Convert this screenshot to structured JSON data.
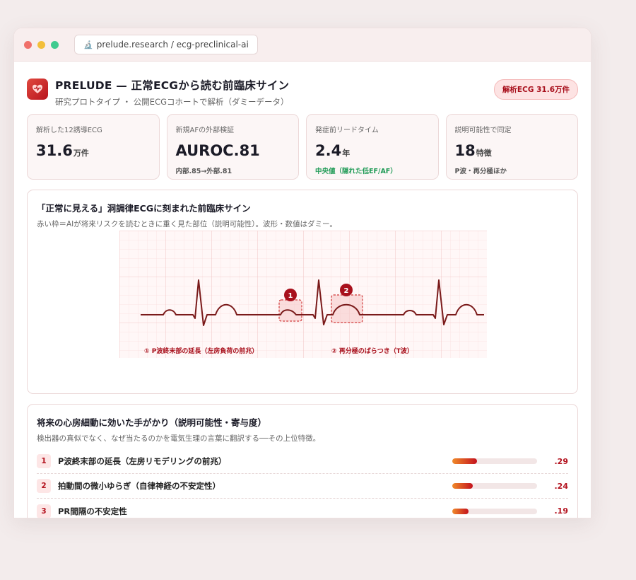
{
  "browser": {
    "url": "prelude.research / ecg-preclinical-ai",
    "url_icon": "microscope-icon"
  },
  "header": {
    "title": "PRELUDE — 正常ECGから読む前臨床サイン",
    "subtitle": "研究プロトタイプ ・ 公開ECGコホートで解析（ダミーデータ）",
    "badge": "解析ECG 31.6万件",
    "icon": "heart-icon"
  },
  "stats": [
    {
      "label": "解析した12誘導ECG",
      "value": "31.6",
      "unit": "万件",
      "note": "",
      "note_color": ""
    },
    {
      "label": "新規AFの外部検証",
      "value": "AUROC.81",
      "unit": "",
      "note": "内部.85→外部.81",
      "note_color": ""
    },
    {
      "label": "発症前リードタイム",
      "value": "2.4",
      "unit": "年",
      "note": "中央値（隠れた低EF/AF）",
      "note_color": "green"
    },
    {
      "label": "説明可能性で同定",
      "value": "18",
      "unit": "特徴",
      "note": "P波・再分極ほか",
      "note_color": ""
    }
  ],
  "ecg": {
    "title": "「正常に見える」洞調律ECGに刻まれた前臨床サイン",
    "subtitle": "赤い枠＝AIが将来リスクを読むときに重く見た部位（説明可能性）。波形・数値はダミー。",
    "markers": [
      {
        "num": "1",
        "caption": "① P波終末部の延長（左房負荷の前兆）"
      },
      {
        "num": "2",
        "caption": "② 再分極のばらつき（T波）"
      }
    ]
  },
  "features": {
    "title": "将来の心房細動に効いた手がかり（説明可能性・寄与度）",
    "subtitle": "検出器の真似でなく、なぜ当たるのかを電気生理の言葉に翻訳する──その上位特徴。",
    "items": [
      {
        "rank": "1",
        "label": "P波終末部の延長（左房リモデリングの前兆）",
        "value": ".29",
        "score": 0.29
      },
      {
        "rank": "2",
        "label": "拍動間の微小ゆらぎ（自律神経の不安定性）",
        "value": ".24",
        "score": 0.24
      },
      {
        "rank": "3",
        "label": "PR間隔の不安定性",
        "value": ".19",
        "score": 0.19
      }
    ]
  },
  "colors": {
    "accent": "#b3121e",
    "ecg_trace": "#7a1a1a",
    "grid_major": "#f1c9c9",
    "grid_minor": "#fae4e4"
  }
}
